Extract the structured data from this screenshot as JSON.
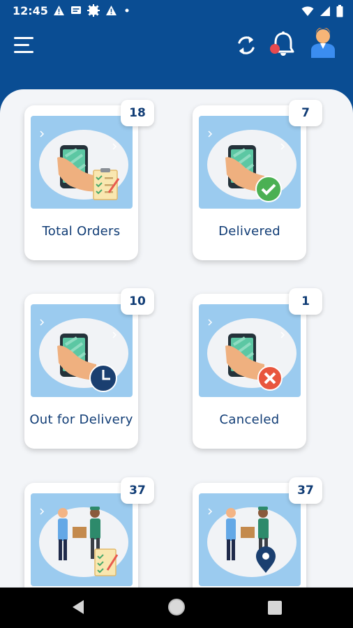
{
  "status_bar": {
    "time": "12:45",
    "left_icons": [
      "warning-icon",
      "message-icon",
      "settings-icon",
      "warning-icon",
      "dot-icon"
    ],
    "right_icons": [
      "wifi-icon",
      "signal-icon",
      "battery-icon"
    ]
  },
  "app_bar": {
    "icons": [
      "menu-icon",
      "refresh-icon",
      "bell-icon",
      "user-icon"
    ],
    "accent_color": "#0a4d93"
  },
  "cards": [
    {
      "label": "Total Orders",
      "count": "18",
      "image": "phone-clipboard-icon"
    },
    {
      "label": "Delivered",
      "count": "7",
      "image": "phone-check-icon"
    },
    {
      "label": "Out for Delivery",
      "count": "10",
      "image": "phone-clock-icon"
    },
    {
      "label": "Canceled",
      "count": "1",
      "image": "phone-cancel-icon"
    },
    {
      "label": "",
      "count": "37",
      "image": "delivery-clipboard-icon"
    },
    {
      "label": "",
      "count": "37",
      "image": "delivery-location-icon"
    }
  ],
  "nav_bar": {
    "icons": [
      "back-icon",
      "home-icon",
      "recent-apps-icon"
    ]
  }
}
